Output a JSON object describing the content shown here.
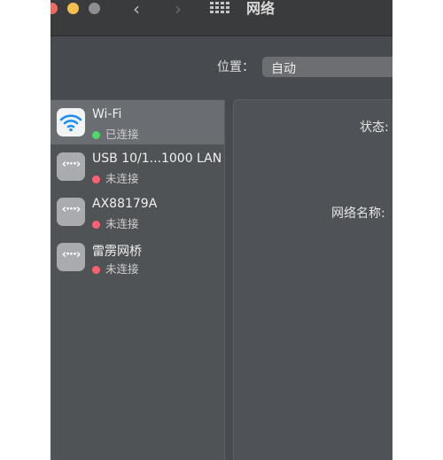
{
  "window": {
    "title": "网络",
    "traffic_lights": [
      "#ed6a5e",
      "#f5bf4f",
      "#8e8e90"
    ]
  },
  "toolbar": {
    "back_icon": "chevron-left-icon",
    "forward_icon": "chevron-right-icon",
    "grid_icon": "grid-icon"
  },
  "location": {
    "label": "位置：",
    "value": "自动"
  },
  "sidebar": {
    "items": [
      {
        "name": "Wi-Fi",
        "status": "已连接",
        "status_color": "#4cd964",
        "icon": "wifi-icon",
        "selected": true
      },
      {
        "name": "USB 10/1...1000 LAN",
        "status": "未连接",
        "status_color": "#ff5f71",
        "icon": "ethernet-icon",
        "selected": false
      },
      {
        "name": "AX88179A",
        "status": "未连接",
        "status_color": "#ff5f71",
        "icon": "ethernet-icon",
        "selected": false
      },
      {
        "name": "雷雳网桥",
        "status": "未连接",
        "status_color": "#ff5f71",
        "icon": "ethernet-icon",
        "selected": false
      }
    ]
  },
  "detail": {
    "status_label": "状态:",
    "network_name_label": "网络名称:"
  },
  "colors": {
    "wifi_blue": "#1e8ef2",
    "window_bg": "#474a4e"
  }
}
